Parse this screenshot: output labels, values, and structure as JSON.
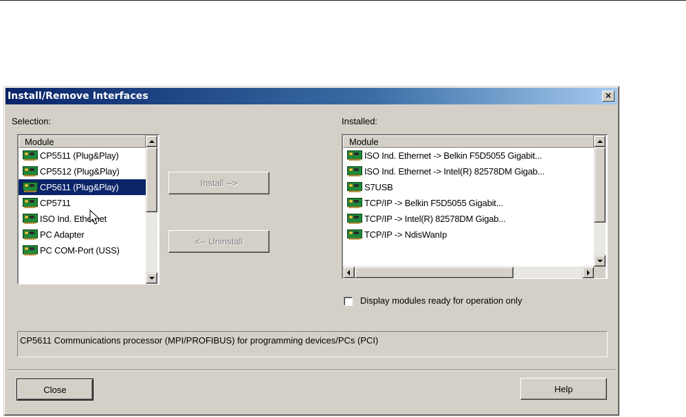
{
  "dialog": {
    "title": "Install/Remove Interfaces",
    "close_glyph": "×"
  },
  "selection": {
    "label": "Selection:",
    "column_header": "Module",
    "items": [
      {
        "label": "CP5511 (Plug&Play)",
        "icon": "network-card-icon",
        "selected": false
      },
      {
        "label": "CP5512 (Plug&Play)",
        "icon": "network-card-icon",
        "selected": false
      },
      {
        "label": "CP5611 (Plug&Play)",
        "icon": "network-card-icon",
        "selected": true
      },
      {
        "label": "CP5711",
        "icon": "network-card-icon",
        "selected": false
      },
      {
        "label": "ISO Ind. Ethernet",
        "icon": "network-card-icon",
        "selected": false
      },
      {
        "label": "PC Adapter",
        "icon": "network-card-icon",
        "selected": false
      },
      {
        "label": "PC COM-Port (USS)",
        "icon": "network-card-icon",
        "selected": false
      }
    ]
  },
  "actions": {
    "install_label": "Install -->",
    "uninstall_label": "<-- Uninstall"
  },
  "installed": {
    "label": "Installed:",
    "column_header": "Module",
    "items": [
      {
        "label": "ISO Ind. Ethernet -> Belkin F5D5055 Gigabit...",
        "icon": "network-card-icon"
      },
      {
        "label": "ISO Ind. Ethernet -> Intel(R) 82578DM Gigab...",
        "icon": "network-card-icon"
      },
      {
        "label": "S7USB",
        "icon": "network-card-icon"
      },
      {
        "label": "TCP/IP -> Belkin F5D5055 Gigabit...",
        "icon": "network-card-icon"
      },
      {
        "label": "TCP/IP -> Intel(R) 82578DM Gigab...",
        "icon": "network-card-icon"
      },
      {
        "label": "TCP/IP -> NdisWanIp",
        "icon": "network-card-icon"
      }
    ]
  },
  "filter": {
    "checkbox_label": "Display modules ready for operation only",
    "checked": false
  },
  "description": "CP5611 Communications processor (MPI/PROFIBUS) for programming devices/PCs (PCI)",
  "footer": {
    "close_label": "Close",
    "help_label": "Help"
  },
  "colors": {
    "title_start": "#0a246a",
    "title_end": "#a6caf0",
    "selection_highlight": "#0a246a",
    "dialog_face": "#d4d0c8"
  }
}
